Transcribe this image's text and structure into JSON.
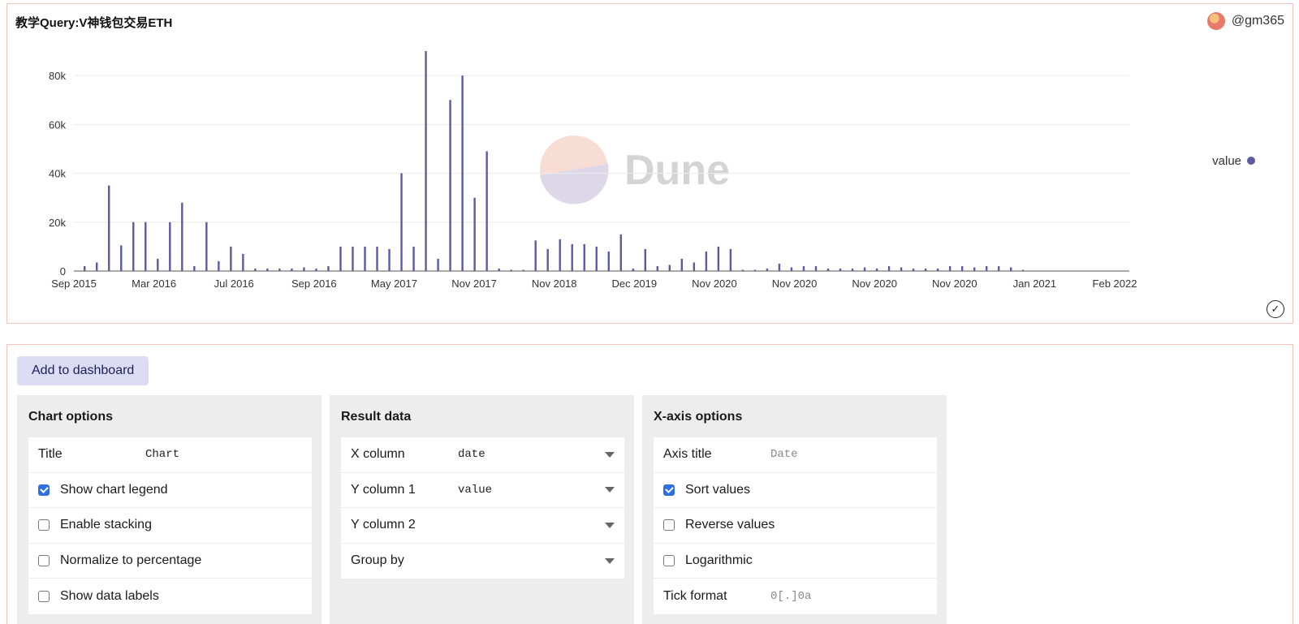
{
  "chart_card": {
    "title": "教学Query:V神钱包交易ETH",
    "user": "@gm365",
    "watermark": "Dune"
  },
  "chart_data": {
    "type": "bar",
    "title": "",
    "xlabel": "",
    "ylabel": "",
    "ylim": [
      0,
      90000
    ],
    "y_ticks": [
      "0",
      "20k",
      "40k",
      "60k",
      "80k"
    ],
    "x_tick_labels": [
      "Sep 2015",
      "Mar 2016",
      "Jul 2016",
      "Sep 2016",
      "May 2017",
      "Nov 2017",
      "Nov 2018",
      "Dec 2019",
      "Nov 2020",
      "Nov 2020",
      "Nov 2020",
      "Nov 2020",
      "Jan 2021",
      "Feb 2022"
    ],
    "legend": {
      "position": "right",
      "entries": [
        "value"
      ]
    },
    "grid": true,
    "series": [
      {
        "name": "value",
        "color": "#5b5ba3",
        "values": [
          2000,
          3500,
          35000,
          10500,
          20000,
          20000,
          5000,
          20000,
          28000,
          2000,
          20000,
          4000,
          10000,
          7000,
          1000,
          1000,
          1000,
          1000,
          1500,
          1000,
          2000,
          10000,
          10000,
          10000,
          10000,
          9000,
          40000,
          10000,
          90000,
          5000,
          70000,
          80000,
          30000,
          49000,
          1000,
          500,
          500,
          12500,
          9000,
          13000,
          11000,
          11000,
          10000,
          8000,
          15000,
          1000,
          9000,
          2000,
          2500,
          5000,
          3500,
          8000,
          10000,
          9000,
          500,
          500,
          1000,
          3000,
          1500,
          2000,
          2000,
          1000,
          1000,
          1000,
          1500,
          1000,
          2000,
          1500,
          1000,
          1000,
          1000,
          2000,
          2000,
          1500,
          2000,
          2000,
          1500,
          500
        ]
      }
    ]
  },
  "toolbar": {
    "add_label": "Add to dashboard"
  },
  "chart_options": {
    "heading": "Chart options",
    "title_label": "Title",
    "title_value": "Chart",
    "show_legend_label": "Show chart legend",
    "show_legend_checked": true,
    "stacking_label": "Enable stacking",
    "normalize_label": "Normalize to percentage",
    "data_labels_label": "Show data labels"
  },
  "result_data": {
    "heading": "Result data",
    "x_label": "X column",
    "x_value": "date",
    "y1_label": "Y column 1",
    "y1_value": "value",
    "y2_label": "Y column 2",
    "group_label": "Group by"
  },
  "x_axis": {
    "heading": "X-axis options",
    "axis_title_label": "Axis title",
    "axis_title_placeholder": "Date",
    "sort_label": "Sort values",
    "sort_checked": true,
    "reverse_label": "Reverse values",
    "log_label": "Logarithmic",
    "tick_label": "Tick format",
    "tick_placeholder": "0[.]0a"
  }
}
